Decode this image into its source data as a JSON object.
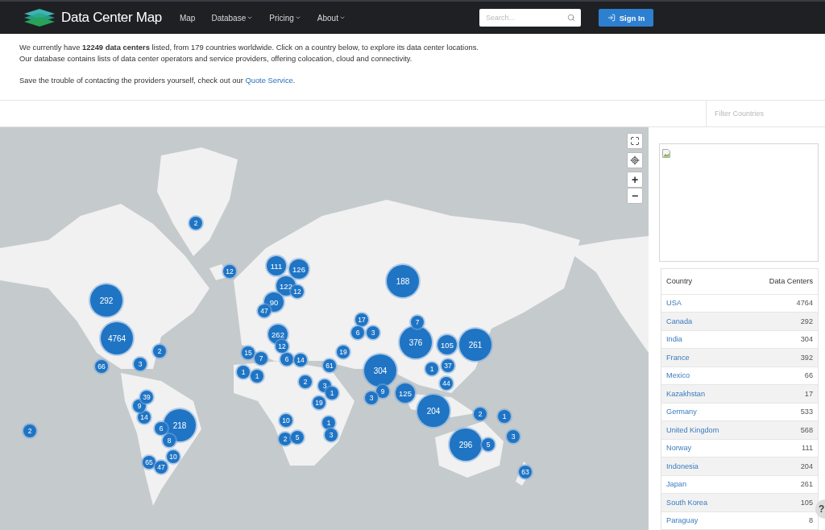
{
  "header": {
    "logo": "Data Center Map",
    "nav": [
      {
        "label": "Map",
        "dropdown": false
      },
      {
        "label": "Database",
        "dropdown": true
      },
      {
        "label": "Pricing",
        "dropdown": true
      },
      {
        "label": "About",
        "dropdown": true
      }
    ],
    "search": {
      "placeholder": "Search..."
    },
    "sign_in": "Sign In"
  },
  "intro": {
    "lines": [
      "We currently have **12249 data centers** listed, from 179 countries worldwide. Click on a country below, to explore its data center locations.",
      "Our database contains lists of data center operators and service providers, offering colocation, cloud and connectivity."
    ],
    "quote_text": "Save the trouble of contacting the providers yourself, check out our ",
    "quote_link": "Quote Service",
    "quote_end": "."
  },
  "filter": {
    "placeholder": "Filter Countries"
  },
  "map": {
    "controls": {
      "zoom_in": "+",
      "zoom_out": "−"
    },
    "markers": [
      {
        "count": "2",
        "kind": "small"
      },
      {
        "count": "12",
        "kind": "small"
      },
      {
        "count": "111",
        "kind": "medium"
      },
      {
        "count": "126",
        "kind": "medium"
      },
      {
        "count": "122",
        "kind": "medium"
      },
      {
        "count": "292",
        "kind": "large"
      },
      {
        "count": "4764",
        "kind": "large"
      },
      {
        "count": "2",
        "kind": "small"
      },
      {
        "count": "66",
        "kind": "small"
      },
      {
        "count": "3",
        "kind": "small"
      },
      {
        "count": "2",
        "kind": "small"
      },
      {
        "count": "218",
        "kind": "large"
      },
      {
        "count": "6",
        "kind": "small"
      },
      {
        "count": "8",
        "kind": "small"
      },
      {
        "count": "10",
        "kind": "small"
      },
      {
        "count": "65",
        "kind": "small"
      },
      {
        "count": "47",
        "kind": "small"
      },
      {
        "count": "14",
        "kind": "small"
      },
      {
        "count": "9",
        "kind": "small"
      },
      {
        "count": "39",
        "kind": "small"
      },
      {
        "count": "90",
        "kind": "medium"
      },
      {
        "count": "12",
        "kind": "small"
      },
      {
        "count": "47",
        "kind": "small"
      },
      {
        "count": "262",
        "kind": "medium"
      },
      {
        "count": "15",
        "kind": "small"
      },
      {
        "count": "7",
        "kind": "small"
      },
      {
        "count": "6",
        "kind": "small"
      },
      {
        "count": "12",
        "kind": "small"
      },
      {
        "count": "14",
        "kind": "small"
      },
      {
        "count": "61",
        "kind": "small"
      },
      {
        "count": "19",
        "kind": "small"
      },
      {
        "count": "17",
        "kind": "small"
      },
      {
        "count": "6",
        "kind": "small"
      },
      {
        "count": "3",
        "kind": "small"
      },
      {
        "count": "188",
        "kind": "large"
      },
      {
        "count": "376",
        "kind": "large"
      },
      {
        "count": "304",
        "kind": "large"
      },
      {
        "count": "7",
        "kind": "small"
      },
      {
        "count": "105",
        "kind": "medium"
      },
      {
        "count": "261",
        "kind": "large"
      },
      {
        "count": "37",
        "kind": "small"
      },
      {
        "count": "44",
        "kind": "small"
      },
      {
        "count": "1",
        "kind": "small"
      },
      {
        "count": "125",
        "kind": "medium"
      },
      {
        "count": "204",
        "kind": "large"
      },
      {
        "count": "9",
        "kind": "small"
      },
      {
        "count": "3",
        "kind": "small"
      },
      {
        "count": "2",
        "kind": "small"
      },
      {
        "count": "1",
        "kind": "small"
      },
      {
        "count": "296",
        "kind": "large"
      },
      {
        "count": "5",
        "kind": "small"
      },
      {
        "count": "3",
        "kind": "small"
      },
      {
        "count": "63",
        "kind": "small"
      },
      {
        "count": "1",
        "kind": "small"
      },
      {
        "count": "1",
        "kind": "small"
      },
      {
        "count": "2",
        "kind": "small"
      },
      {
        "count": "3",
        "kind": "small"
      },
      {
        "count": "1",
        "kind": "small"
      },
      {
        "count": "10",
        "kind": "small"
      },
      {
        "count": "1",
        "kind": "small"
      },
      {
        "count": "19",
        "kind": "small"
      },
      {
        "count": "2",
        "kind": "small"
      },
      {
        "count": "5",
        "kind": "small"
      },
      {
        "count": "3",
        "kind": "small"
      }
    ]
  },
  "table": {
    "columns": [
      "Country",
      "Data Centers"
    ],
    "rows": [
      {
        "country": "USA",
        "count": "4764"
      },
      {
        "country": "Canada",
        "count": "292"
      },
      {
        "country": "India",
        "count": "304"
      },
      {
        "country": "France",
        "count": "392"
      },
      {
        "country": "Mexico",
        "count": "66"
      },
      {
        "country": "Kazakhstan",
        "count": "17"
      },
      {
        "country": "Germany",
        "count": "533"
      },
      {
        "country": "United Kingdom",
        "count": "568"
      },
      {
        "country": "Norway",
        "count": "111"
      },
      {
        "country": "Indonesia",
        "count": "204"
      },
      {
        "country": "Japan",
        "count": "261"
      },
      {
        "country": "South Korea",
        "count": "105"
      },
      {
        "country": "Paraguay",
        "count": "8"
      }
    ]
  },
  "help": "?"
}
